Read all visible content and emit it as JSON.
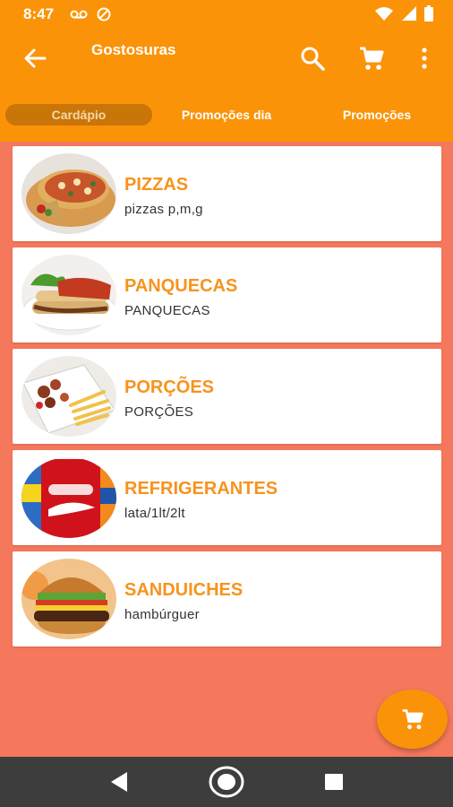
{
  "status_bar": {
    "time": "8:47",
    "icons": [
      "voicemail-icon",
      "data-saver-icon",
      "wifi-icon",
      "signal-icon",
      "battery-icon"
    ]
  },
  "app_bar": {
    "title": "Gostosuras",
    "actions": [
      "search-icon",
      "cart-icon",
      "more-vert-icon"
    ]
  },
  "tabs": [
    {
      "label": "Cardápio",
      "active": true
    },
    {
      "label": "Promoções dia",
      "active": false
    },
    {
      "label": "Promoções",
      "active": false
    }
  ],
  "categories": [
    {
      "title": "PIZZAS",
      "subtitle": "pizzas p,m,g",
      "image": "pizza-photo"
    },
    {
      "title": "PANQUECAS",
      "subtitle": "PANQUECAS",
      "image": "pancakes-photo"
    },
    {
      "title": "PORÇÕES",
      "subtitle": "PORÇÕES",
      "image": "portions-photo"
    },
    {
      "title": "REFRIGERANTES",
      "subtitle": "lata/1lt/2lt",
      "image": "soda-cans-photo"
    },
    {
      "title": "SANDUICHES",
      "subtitle": "hambúrguer",
      "image": "burger-photo"
    }
  ],
  "fab": {
    "icon": "cart-icon"
  },
  "nav_bar": [
    "back-triangle-icon",
    "home-circle-icon",
    "recents-square-icon"
  ],
  "colors": {
    "accent": "#fb9308",
    "background": "#f5785c",
    "category_title": "#f7931e",
    "tab_active_bg": "#c97508"
  }
}
